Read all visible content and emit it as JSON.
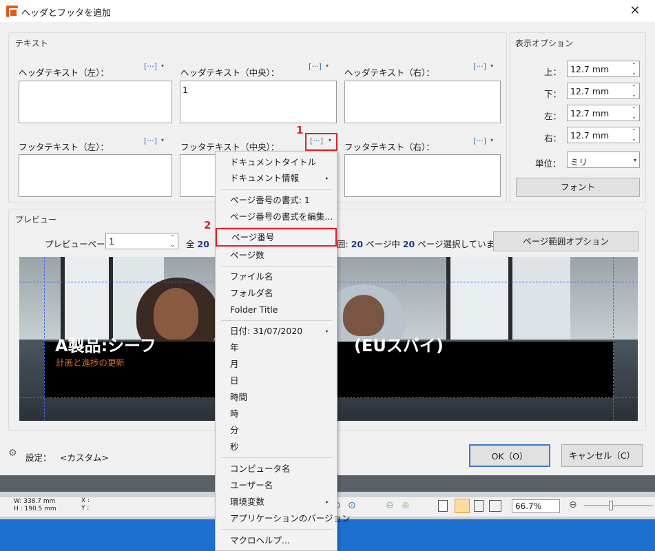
{
  "window": {
    "title": "ヘッダとフッタを追加",
    "close": "✕"
  },
  "text_group": {
    "title": "テキスト",
    "header_left_label": "ヘッダテキスト（左）：",
    "header_center_label": "ヘッダテキスト（中央）：",
    "header_right_label": "ヘッダテキスト（右）：",
    "header_center_value": "1",
    "footer_left_label": "フッタテキスト（左）：",
    "footer_center_label": "フッタテキスト（中央）：",
    "footer_right_label": "フッタテキスト（右）：",
    "macro_btn": "[···]",
    "macro_arrow": "▾"
  },
  "display_options": {
    "title": "表示オプション",
    "top_label": "上：",
    "bottom_label": "下：",
    "left_label": "左：",
    "right_label": "右：",
    "top": "12.7 mm",
    "bottom": "12.7 mm",
    "left": "12.7 mm",
    "right": "12.7 mm",
    "unit_label": "単位：",
    "unit": "ミリ",
    "font_button": "フォント"
  },
  "preview": {
    "title": "プレビュー",
    "page_label": "プレビューページ",
    "page_value": "1",
    "total_prefix": "全",
    "total_number": "20",
    "range_text_prefix": "囲:",
    "range_text_a": "20",
    "range_text_mid": "ページ中",
    "range_text_b": "20",
    "range_text_suffix": "ページ選択しています",
    "range_button": "ページ範囲オプション",
    "slide_title": "A製品:シーフ",
    "slide_title_right": "(EUスバイ)",
    "slide_subtitle": "計画と進捗の更新"
  },
  "footer": {
    "settings_label": "設定：",
    "settings_value": "<カスタム>",
    "ok": "OK（O）",
    "cancel": "キャンセル（C）"
  },
  "statusbar": {
    "w": "W: 338.7 mm",
    "h": "H : 190.5 mm",
    "x": "X :",
    "y": "Y :",
    "zoom": "66.7%"
  },
  "annotations": {
    "step1": "1",
    "step2": "2"
  },
  "menu": {
    "items": [
      "ドキュメントタイトル",
      "ドキュメント情報",
      "ページ番号の書式: 1",
      "ページ番号の書式を編集...",
      "ページ番号",
      "ページ数",
      "ファイル名",
      "フォルダ名",
      "Folder Title",
      "日付: 31/07/2020",
      "年",
      "月",
      "日",
      "時間",
      "時",
      "分",
      "秒",
      "コンピュータ名",
      "ユーザー名",
      "環境変数",
      "アプリケーションのバージョン",
      "マクロヘルプ..."
    ],
    "submenu_arrow": "▸"
  },
  "colors": {
    "accent_red": "#e0202a",
    "slide_orange": "#e06a2a",
    "link_blue": "#2f6fb5"
  }
}
